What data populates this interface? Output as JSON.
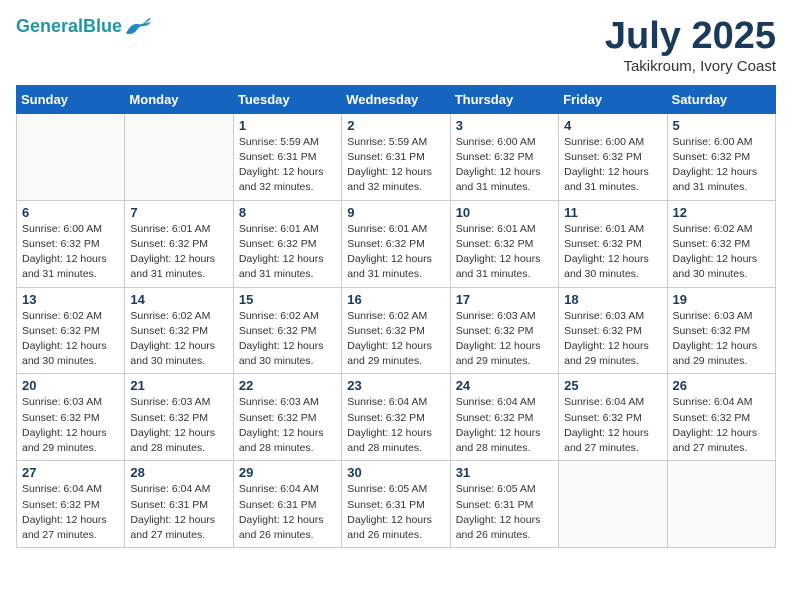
{
  "header": {
    "logo_line1": "General",
    "logo_line2": "Blue",
    "month_title": "July 2025",
    "location": "Takikroum, Ivory Coast"
  },
  "days_of_week": [
    "Sunday",
    "Monday",
    "Tuesday",
    "Wednesday",
    "Thursday",
    "Friday",
    "Saturday"
  ],
  "weeks": [
    [
      {
        "day": "",
        "info": ""
      },
      {
        "day": "",
        "info": ""
      },
      {
        "day": "1",
        "info": "Sunrise: 5:59 AM\nSunset: 6:31 PM\nDaylight: 12 hours and 32 minutes."
      },
      {
        "day": "2",
        "info": "Sunrise: 5:59 AM\nSunset: 6:31 PM\nDaylight: 12 hours and 32 minutes."
      },
      {
        "day": "3",
        "info": "Sunrise: 6:00 AM\nSunset: 6:32 PM\nDaylight: 12 hours and 31 minutes."
      },
      {
        "day": "4",
        "info": "Sunrise: 6:00 AM\nSunset: 6:32 PM\nDaylight: 12 hours and 31 minutes."
      },
      {
        "day": "5",
        "info": "Sunrise: 6:00 AM\nSunset: 6:32 PM\nDaylight: 12 hours and 31 minutes."
      }
    ],
    [
      {
        "day": "6",
        "info": "Sunrise: 6:00 AM\nSunset: 6:32 PM\nDaylight: 12 hours and 31 minutes."
      },
      {
        "day": "7",
        "info": "Sunrise: 6:01 AM\nSunset: 6:32 PM\nDaylight: 12 hours and 31 minutes."
      },
      {
        "day": "8",
        "info": "Sunrise: 6:01 AM\nSunset: 6:32 PM\nDaylight: 12 hours and 31 minutes."
      },
      {
        "day": "9",
        "info": "Sunrise: 6:01 AM\nSunset: 6:32 PM\nDaylight: 12 hours and 31 minutes."
      },
      {
        "day": "10",
        "info": "Sunrise: 6:01 AM\nSunset: 6:32 PM\nDaylight: 12 hours and 31 minutes."
      },
      {
        "day": "11",
        "info": "Sunrise: 6:01 AM\nSunset: 6:32 PM\nDaylight: 12 hours and 30 minutes."
      },
      {
        "day": "12",
        "info": "Sunrise: 6:02 AM\nSunset: 6:32 PM\nDaylight: 12 hours and 30 minutes."
      }
    ],
    [
      {
        "day": "13",
        "info": "Sunrise: 6:02 AM\nSunset: 6:32 PM\nDaylight: 12 hours and 30 minutes."
      },
      {
        "day": "14",
        "info": "Sunrise: 6:02 AM\nSunset: 6:32 PM\nDaylight: 12 hours and 30 minutes."
      },
      {
        "day": "15",
        "info": "Sunrise: 6:02 AM\nSunset: 6:32 PM\nDaylight: 12 hours and 30 minutes."
      },
      {
        "day": "16",
        "info": "Sunrise: 6:02 AM\nSunset: 6:32 PM\nDaylight: 12 hours and 29 minutes."
      },
      {
        "day": "17",
        "info": "Sunrise: 6:03 AM\nSunset: 6:32 PM\nDaylight: 12 hours and 29 minutes."
      },
      {
        "day": "18",
        "info": "Sunrise: 6:03 AM\nSunset: 6:32 PM\nDaylight: 12 hours and 29 minutes."
      },
      {
        "day": "19",
        "info": "Sunrise: 6:03 AM\nSunset: 6:32 PM\nDaylight: 12 hours and 29 minutes."
      }
    ],
    [
      {
        "day": "20",
        "info": "Sunrise: 6:03 AM\nSunset: 6:32 PM\nDaylight: 12 hours and 29 minutes."
      },
      {
        "day": "21",
        "info": "Sunrise: 6:03 AM\nSunset: 6:32 PM\nDaylight: 12 hours and 28 minutes."
      },
      {
        "day": "22",
        "info": "Sunrise: 6:03 AM\nSunset: 6:32 PM\nDaylight: 12 hours and 28 minutes."
      },
      {
        "day": "23",
        "info": "Sunrise: 6:04 AM\nSunset: 6:32 PM\nDaylight: 12 hours and 28 minutes."
      },
      {
        "day": "24",
        "info": "Sunrise: 6:04 AM\nSunset: 6:32 PM\nDaylight: 12 hours and 28 minutes."
      },
      {
        "day": "25",
        "info": "Sunrise: 6:04 AM\nSunset: 6:32 PM\nDaylight: 12 hours and 27 minutes."
      },
      {
        "day": "26",
        "info": "Sunrise: 6:04 AM\nSunset: 6:32 PM\nDaylight: 12 hours and 27 minutes."
      }
    ],
    [
      {
        "day": "27",
        "info": "Sunrise: 6:04 AM\nSunset: 6:32 PM\nDaylight: 12 hours and 27 minutes."
      },
      {
        "day": "28",
        "info": "Sunrise: 6:04 AM\nSunset: 6:31 PM\nDaylight: 12 hours and 27 minutes."
      },
      {
        "day": "29",
        "info": "Sunrise: 6:04 AM\nSunset: 6:31 PM\nDaylight: 12 hours and 26 minutes."
      },
      {
        "day": "30",
        "info": "Sunrise: 6:05 AM\nSunset: 6:31 PM\nDaylight: 12 hours and 26 minutes."
      },
      {
        "day": "31",
        "info": "Sunrise: 6:05 AM\nSunset: 6:31 PM\nDaylight: 12 hours and 26 minutes."
      },
      {
        "day": "",
        "info": ""
      },
      {
        "day": "",
        "info": ""
      }
    ]
  ]
}
